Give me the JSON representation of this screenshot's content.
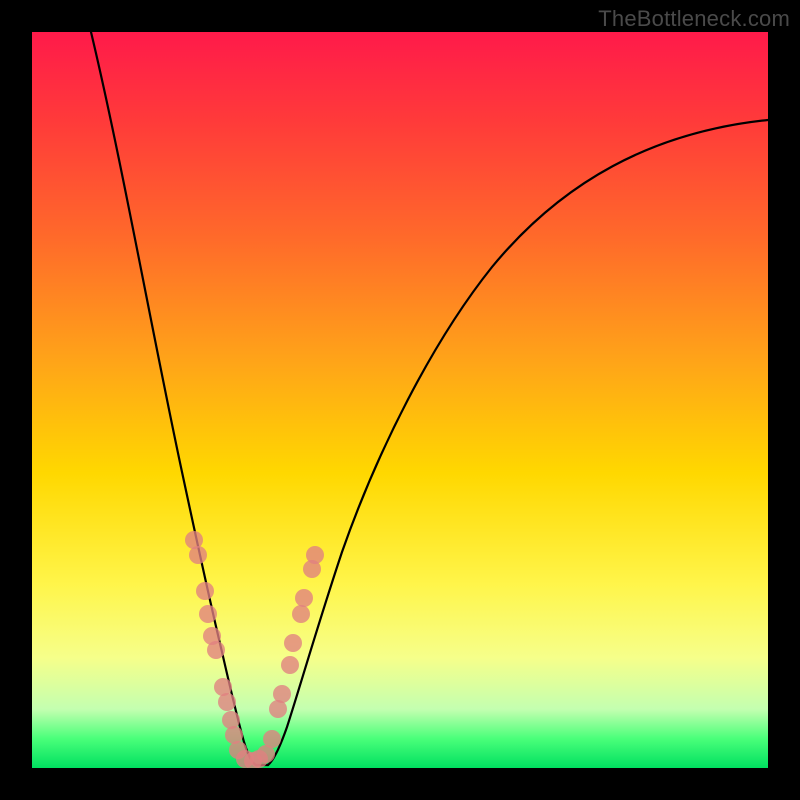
{
  "watermark": "TheBottleneck.com",
  "colors": {
    "frame": "#000000",
    "gradient_top": "#ff1a4a",
    "gradient_mid": "#ffd800",
    "gradient_bottom": "#00e060",
    "curve": "#000000",
    "points": "#e08080"
  },
  "chart_data": {
    "type": "line",
    "title": "",
    "xlabel": "",
    "ylabel": "",
    "xlim": [
      0,
      100
    ],
    "ylim": [
      0,
      100
    ],
    "grid": false,
    "legend": false,
    "series": [
      {
        "name": "bottleneck_curve_left",
        "x": [
          8,
          10,
          12,
          14,
          16,
          18,
          20,
          22,
          24,
          25,
          26,
          27,
          28,
          29
        ],
        "y": [
          100,
          90,
          80,
          70,
          60,
          50,
          40,
          30,
          20,
          15,
          10,
          6,
          3,
          1
        ]
      },
      {
        "name": "bottleneck_curve_right",
        "x": [
          31,
          32,
          33,
          34,
          36,
          40,
          45,
          50,
          55,
          60,
          70,
          80,
          90,
          100
        ],
        "y": [
          1,
          3,
          6,
          10,
          18,
          30,
          42,
          52,
          59,
          65,
          73,
          80,
          84,
          87
        ]
      }
    ],
    "min_segment": {
      "x": [
        29,
        31
      ],
      "y": [
        0.5,
        0.5
      ]
    },
    "highlight_points": {
      "left_branch": [
        {
          "x": 22.0,
          "y": 31
        },
        {
          "x": 22.5,
          "y": 29
        },
        {
          "x": 23.5,
          "y": 24
        },
        {
          "x": 24.0,
          "y": 21
        },
        {
          "x": 24.5,
          "y": 18
        },
        {
          "x": 25.0,
          "y": 16
        },
        {
          "x": 26.0,
          "y": 11
        },
        {
          "x": 26.5,
          "y": 9
        },
        {
          "x": 27.0,
          "y": 6.5
        },
        {
          "x": 27.5,
          "y": 4.5
        }
      ],
      "right_branch": [
        {
          "x": 33.5,
          "y": 8
        },
        {
          "x": 34.0,
          "y": 10
        },
        {
          "x": 35.0,
          "y": 14
        },
        {
          "x": 35.5,
          "y": 17
        },
        {
          "x": 36.5,
          "y": 21
        },
        {
          "x": 37.0,
          "y": 23
        },
        {
          "x": 38.0,
          "y": 27
        },
        {
          "x": 38.5,
          "y": 29
        }
      ],
      "bottom": [
        {
          "x": 28.0,
          "y": 2.5
        },
        {
          "x": 29.0,
          "y": 1.2
        },
        {
          "x": 30.0,
          "y": 1.0
        },
        {
          "x": 30.8,
          "y": 1.2
        },
        {
          "x": 31.8,
          "y": 2.0
        },
        {
          "x": 32.6,
          "y": 4.0
        }
      ]
    }
  }
}
